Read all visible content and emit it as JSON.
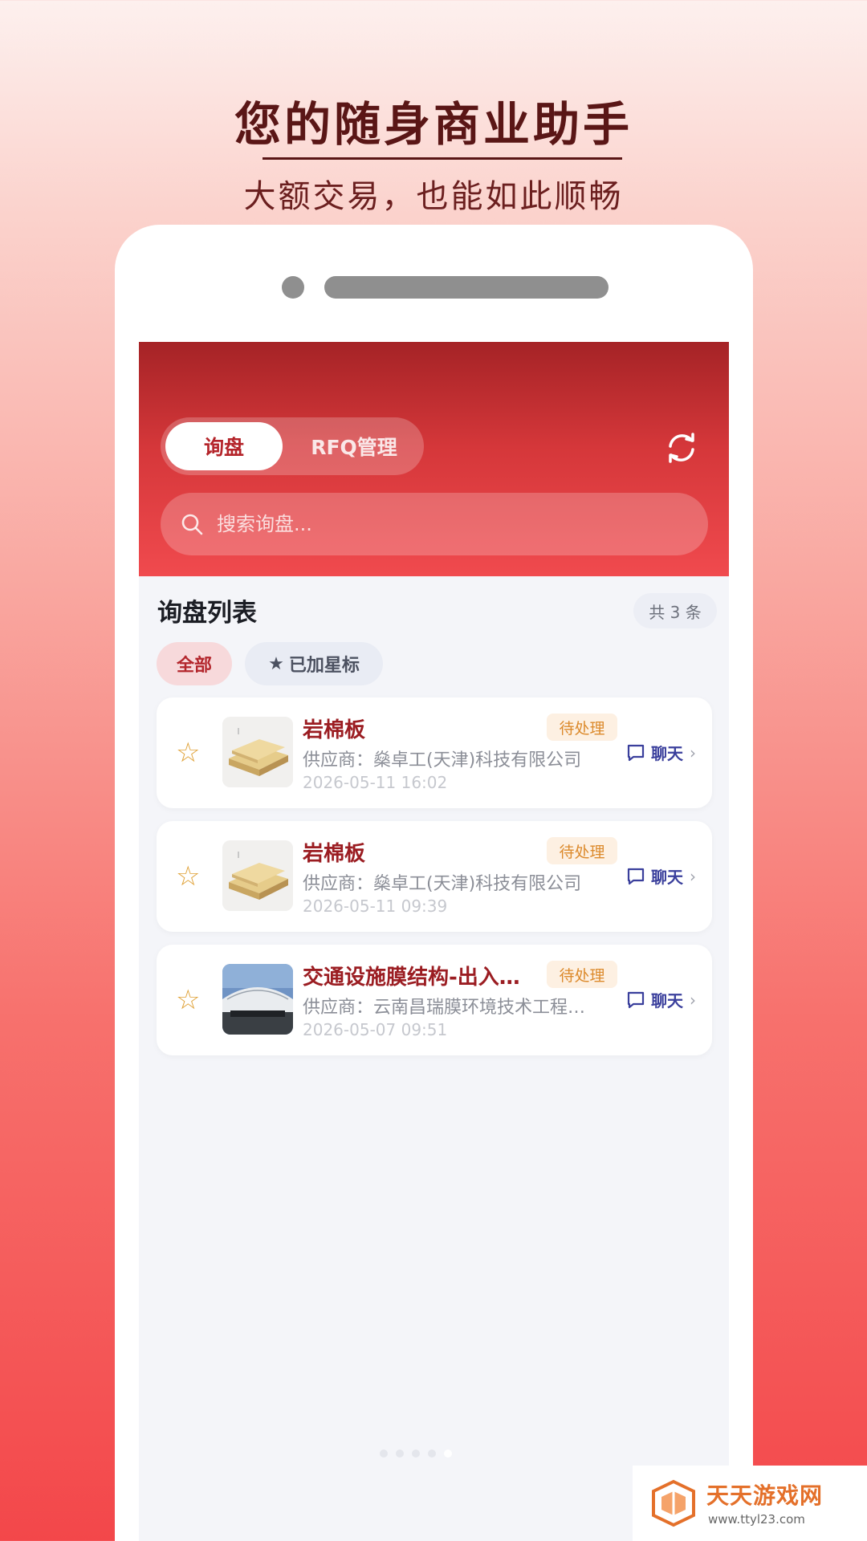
{
  "promo": {
    "title": "您的随身商业助手",
    "subtitle": "大额交易，也能如此顺畅"
  },
  "header": {
    "tabs": [
      {
        "label": "询盘",
        "active": true
      },
      {
        "label": "RFQ管理",
        "active": false
      }
    ],
    "refresh_icon": "refresh-icon",
    "search": {
      "placeholder": "搜索询盘..."
    }
  },
  "list": {
    "title": "询盘列表",
    "count": "共 3 条",
    "filters": {
      "all": "全部",
      "starred_icon": "★",
      "starred": "已加星标"
    },
    "items": [
      {
        "star": "☆",
        "title": "岩棉板",
        "status": "待处理",
        "supplier": "供应商：燊卓工(天津)科技有限公司",
        "time": "2026-05-11 16:02",
        "chat": "聊天",
        "arrow": "›",
        "image": "rock-wool-board"
      },
      {
        "star": "☆",
        "title": "岩棉板",
        "status": "待处理",
        "supplier": "供应商：燊卓工(天津)科技有限公司",
        "time": "2026-05-11 09:39",
        "chat": "聊天",
        "arrow": "›",
        "image": "rock-wool-board"
      },
      {
        "star": "☆",
        "title": "交通设施膜结构-出入…",
        "status": "待处理",
        "supplier": "供应商：云南昌瑞膜环境技术工程…",
        "time": "2026-05-07 09:51",
        "chat": "聊天",
        "arrow": "›",
        "image": "membrane-structure"
      }
    ]
  },
  "watermark": {
    "name": "天天游戏网",
    "url": "www.ttyl23.com"
  },
  "colors": {
    "brand_red": "#b4242a",
    "title_red": "#9b1d22",
    "status_orange": "#dc8a2c",
    "chat_blue": "#3a3f9c",
    "star_gold": "#e0a33a"
  }
}
